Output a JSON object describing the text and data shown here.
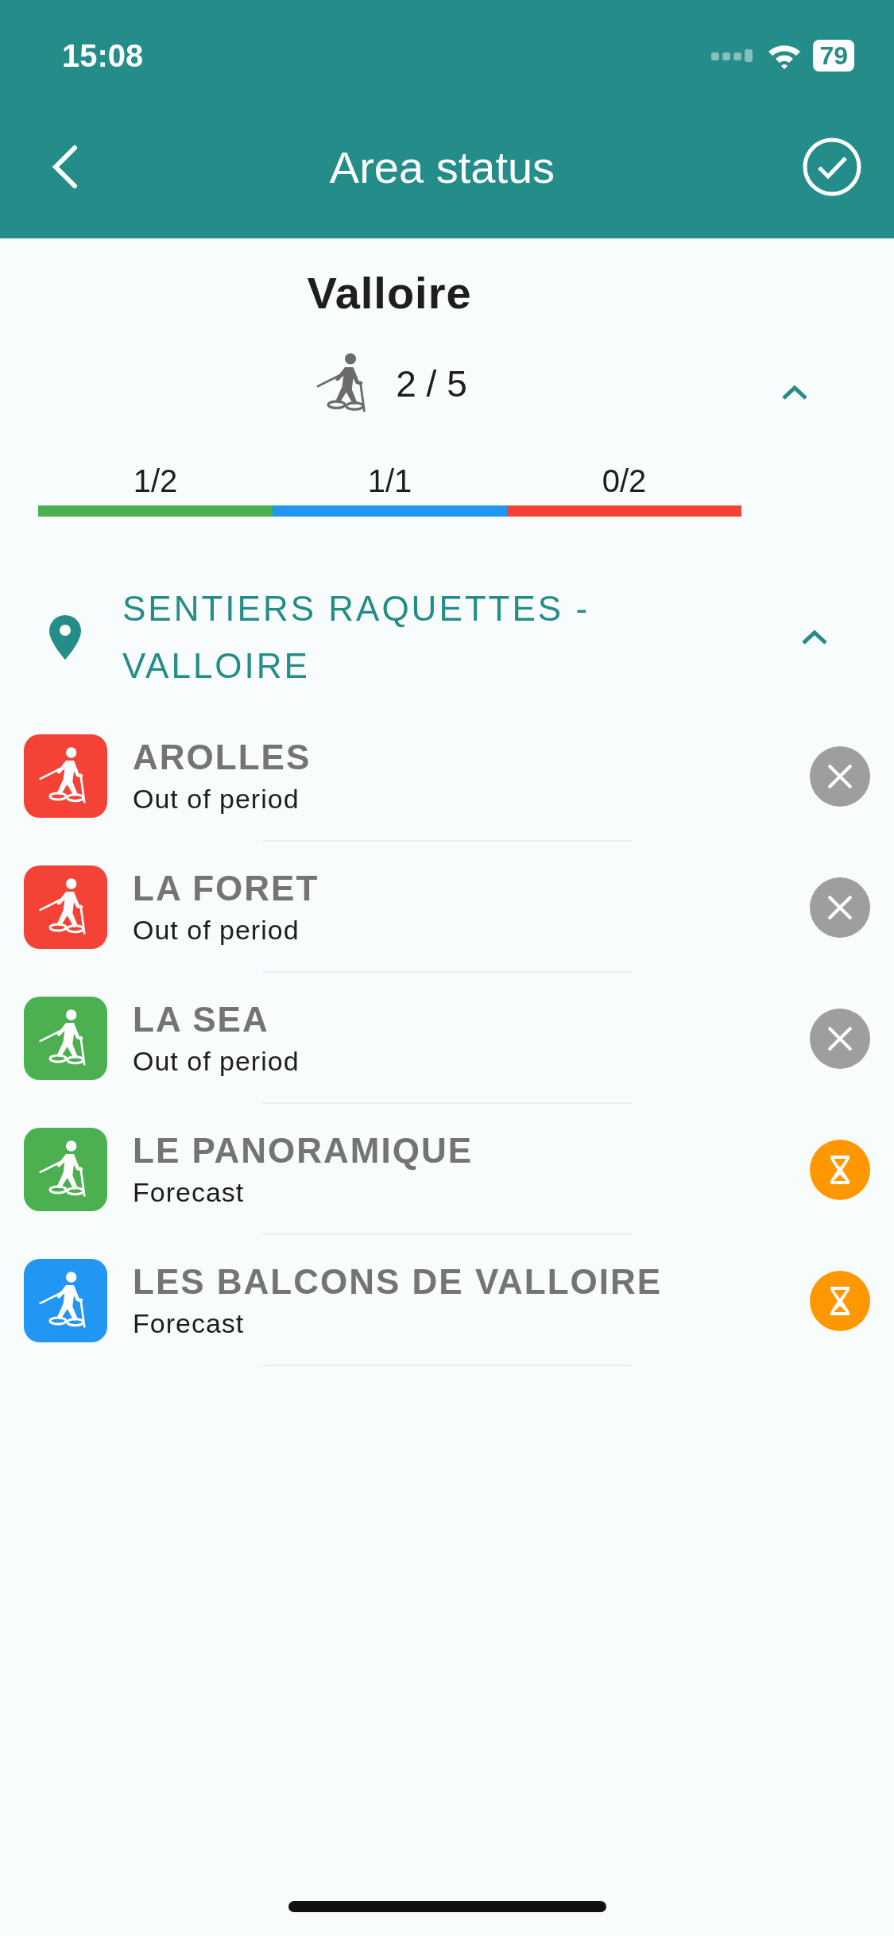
{
  "status_bar": {
    "time": "15:08",
    "battery": "79"
  },
  "nav": {
    "title": "Area status"
  },
  "area": {
    "name": "Valloire",
    "count": "2 / 5",
    "expanded": true,
    "segments": [
      {
        "label": "1/2",
        "color": "#4caf50"
      },
      {
        "label": "1/1",
        "color": "#2196f3"
      },
      {
        "label": "0/2",
        "color": "#f44336"
      }
    ]
  },
  "section": {
    "title": "SENTIERS RAQUETTES - VALLOIRE",
    "expanded": true,
    "trails": [
      {
        "name": "AROLLES",
        "status": "Out of period",
        "color": "#f44336",
        "kind": "closed"
      },
      {
        "name": "LA FORET",
        "status": "Out of period",
        "color": "#f44336",
        "kind": "closed"
      },
      {
        "name": "LA SEA",
        "status": "Out of period",
        "color": "#4caf50",
        "kind": "closed"
      },
      {
        "name": "LE PANORAMIQUE",
        "status": "Forecast",
        "color": "#4caf50",
        "kind": "forecast"
      },
      {
        "name": "LES BALCONS DE VALLOIRE",
        "status": "Forecast",
        "color": "#2196f3",
        "kind": "forecast"
      }
    ]
  }
}
